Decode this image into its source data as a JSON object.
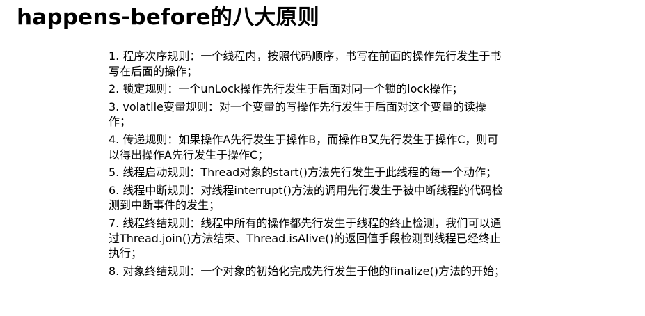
{
  "title": "happens-before的八大原则",
  "rules": [
    {
      "lines": [
        "1. 程序次序规则：一个线程内，按照代码顺序，书写在前面的操作先行发生于书",
        "写在后面的操作；"
      ]
    },
    {
      "lines": [
        "2. 锁定规则：一个unLock操作先行发生于后面对同一个锁的lock操作；"
      ]
    },
    {
      "lines": [
        "3. volatile变量规则：对一个变量的写操作先行发生于后面对这个变量的读操",
        "作；"
      ]
    },
    {
      "lines": [
        "4. 传递规则：如果操作A先行发生于操作B，而操作B又先行发生于操作C，则可",
        "以得出操作A先行发生于操作C；"
      ]
    },
    {
      "lines": [
        "5. 线程启动规则：Thread对象的start()方法先行发生于此线程的每一个动作；"
      ]
    },
    {
      "lines": [
        "6. 线程中断规则：对线程interrupt()方法的调用先行发生于被中断线程的代码检",
        "测到中断事件的发生；"
      ]
    },
    {
      "lines": [
        "7. 线程终结规则：线程中所有的操作都先行发生于线程的终止检测，我们可以通",
        "过Thread.join()方法结束、Thread.isAlive()的返回值手段检测到线程已经终止",
        "执行；"
      ]
    },
    {
      "lines": [
        "8. 对象终结规则：一个对象的初始化完成先行发生于他的finalize()方法的开始；"
      ]
    }
  ]
}
